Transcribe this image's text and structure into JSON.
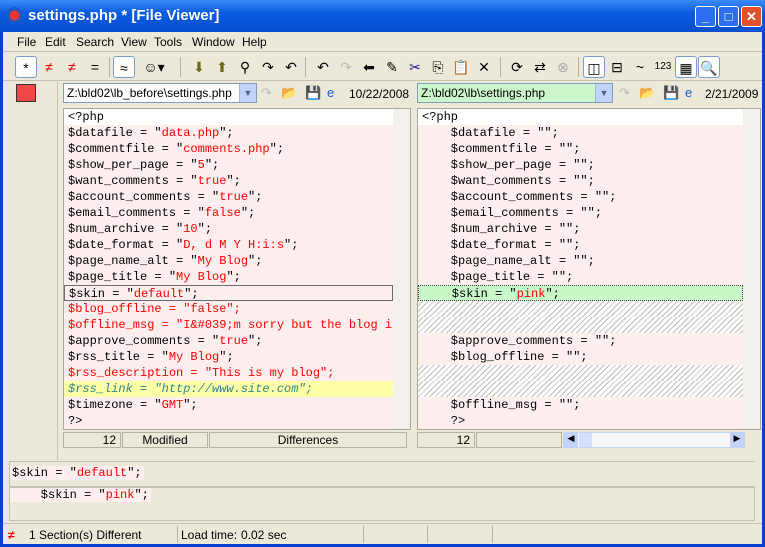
{
  "window": {
    "title": "settings.php *  [File Viewer]"
  },
  "menu": [
    "File",
    "Edit",
    "Search",
    "View",
    "Tools",
    "Window",
    "Help"
  ],
  "toolbar": [
    "all-lines",
    "diff-lines",
    "diff-boxed",
    "same-lines",
    "similar",
    "ignore-rules",
    "next-diff",
    "prev-diff",
    "find",
    "find-next",
    "find-prev",
    "undo",
    "redo",
    "back",
    "edit",
    "cut",
    "copy",
    "paste",
    "delete",
    "refresh",
    "swap",
    "stop",
    "split-vertical",
    "split-horizontal",
    "tilde",
    "line-numbers",
    "insert",
    "zoom"
  ],
  "toolbar_text": {
    "tilde": "~",
    "numbers": "123"
  },
  "left": {
    "path": "Z:\\bld02\\lb_before\\settings.php",
    "date": "10/22/2008",
    "lines": [
      {
        "p": "<?php",
        "s": "",
        "e": "",
        "t": "plain"
      },
      {
        "p": "$datafile = \"",
        "s": "data.php",
        "e": "\";",
        "t": "pink"
      },
      {
        "p": "$commentfile = \"",
        "s": "comments.php",
        "e": "\";",
        "t": "pink"
      },
      {
        "p": "$show_per_page = \"",
        "s": "5",
        "e": "\";",
        "t": "pink"
      },
      {
        "p": "$want_comments = \"",
        "s": "true",
        "e": "\";",
        "t": "pink"
      },
      {
        "p": "$account_comments = \"",
        "s": "true",
        "e": "\";",
        "t": "pink"
      },
      {
        "p": "$email_comments = \"",
        "s": "false",
        "e": "\";",
        "t": "pink"
      },
      {
        "p": "$num_archive = \"",
        "s": "10",
        "e": "\";",
        "t": "pink"
      },
      {
        "p": "$date_format = \"",
        "s": "D, d M Y H:i:s",
        "e": "\";",
        "t": "pink"
      },
      {
        "p": "$page_name_alt = \"",
        "s": "My Blog",
        "e": "\";",
        "t": "pink"
      },
      {
        "p": "$page_title = \"",
        "s": "My Blog",
        "e": "\";",
        "t": "pink"
      },
      {
        "p": "$skin = \"",
        "s": "default",
        "e": "\";",
        "t": "pink sel"
      },
      {
        "p": "$blog_offline = \"false\";",
        "s": "",
        "e": "",
        "t": "pink red"
      },
      {
        "p": "$offline_msg = \"I&#039;m sorry but the blog is",
        "s": "",
        "e": "",
        "t": "pink red"
      },
      {
        "p": "$approve_comments = \"",
        "s": "true",
        "e": "\";",
        "t": "pink"
      },
      {
        "p": "$rss_title = \"",
        "s": "My Blog",
        "e": "\";",
        "t": "pink"
      },
      {
        "p": "$rss_description = \"This is my blog\";",
        "s": "",
        "e": "",
        "t": "pink red"
      },
      {
        "p": "$rss_link = \"http://www.site.com\";",
        "s": "",
        "e": "",
        "t": "yellow"
      },
      {
        "p": "$timezone = \"",
        "s": "GMT",
        "e": "\";",
        "t": "pink"
      },
      {
        "p": "?>",
        "s": "",
        "e": "",
        "t": "pink"
      }
    ],
    "status": {
      "line": "12",
      "state": "Modified",
      "mode": "Differences"
    }
  },
  "right": {
    "path": "Z:\\bld02\\lb\\settings.php",
    "date": "2/21/2009",
    "lines": [
      {
        "p": "<?php",
        "s": "",
        "e": "",
        "t": "plain"
      },
      {
        "p": "    $datafile = \"\";",
        "s": "",
        "e": "",
        "t": "pink"
      },
      {
        "p": "    $commentfile = \"\";",
        "s": "",
        "e": "",
        "t": "pink"
      },
      {
        "p": "    $show_per_page = \"\";",
        "s": "",
        "e": "",
        "t": "pink"
      },
      {
        "p": "    $want_comments = \"\";",
        "s": "",
        "e": "",
        "t": "pink"
      },
      {
        "p": "    $account_comments = \"\";",
        "s": "",
        "e": "",
        "t": "pink"
      },
      {
        "p": "    $email_comments = \"\";",
        "s": "",
        "e": "",
        "t": "pink"
      },
      {
        "p": "    $num_archive = \"\";",
        "s": "",
        "e": "",
        "t": "pink"
      },
      {
        "p": "    $date_format = \"\";",
        "s": "",
        "e": "",
        "t": "pink"
      },
      {
        "p": "    $page_name_alt = \"\";",
        "s": "",
        "e": "",
        "t": "pink"
      },
      {
        "p": "    $page_title = \"\";",
        "s": "",
        "e": "",
        "t": "pink"
      },
      {
        "p": "    $skin = \"",
        "s": "pink",
        "e": "\";",
        "t": "green"
      },
      {
        "p": "",
        "s": "",
        "e": "",
        "t": "hatch"
      },
      {
        "p": "",
        "s": "",
        "e": "",
        "t": "hatch"
      },
      {
        "p": "    $approve_comments = \"\";",
        "s": "",
        "e": "",
        "t": "pink"
      },
      {
        "p": "    $blog_offline = \"\";",
        "s": "",
        "e": "",
        "t": "pink"
      },
      {
        "p": "",
        "s": "",
        "e": "",
        "t": "hatch"
      },
      {
        "p": "",
        "s": "",
        "e": "",
        "t": "hatch"
      },
      {
        "p": "    $offline_msg = \"\";",
        "s": "",
        "e": "",
        "t": "pink"
      },
      {
        "p": "    ?>",
        "s": "",
        "e": "",
        "t": "pink"
      }
    ],
    "status": {
      "line": "12"
    }
  },
  "compare": {
    "left": {
      "p": "$skin = \"",
      "s": "default",
      "e": "\";"
    },
    "right": {
      "p": "    $skin = \"",
      "s": "pink",
      "e": "\";"
    }
  },
  "statusbar": {
    "sections": "1 Section(s) Different",
    "load_label": "Load time:",
    "load_value": "0.02 sec"
  }
}
